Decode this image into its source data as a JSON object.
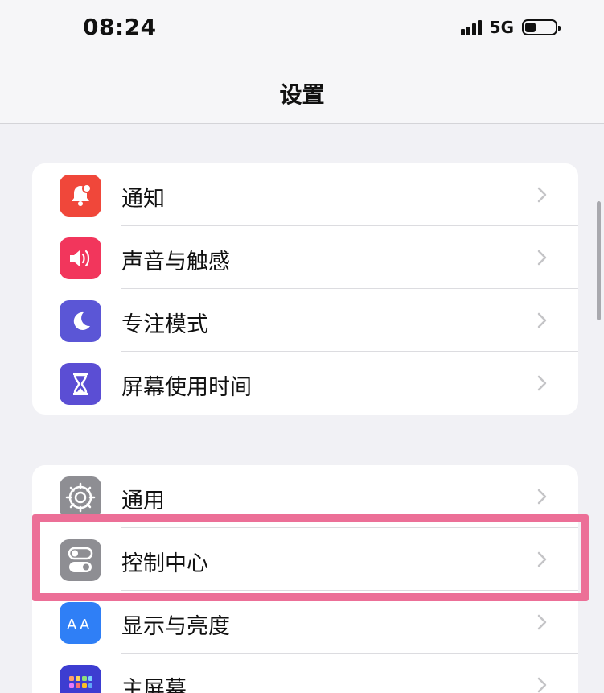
{
  "status_bar": {
    "time": "08:24",
    "network": "5G",
    "battery_level": 0.35
  },
  "nav": {
    "title": "设置"
  },
  "groups": [
    {
      "items": [
        {
          "label": "通知",
          "icon": "notification-icon",
          "color": "#f0473a"
        },
        {
          "label": "声音与触感",
          "icon": "speaker-icon",
          "color": "#f2365c"
        },
        {
          "label": "专注模式",
          "icon": "moon-icon",
          "color": "#5b56d6"
        },
        {
          "label": "屏幕使用时间",
          "icon": "hourglass-icon",
          "color": "#5b4ed4"
        }
      ]
    },
    {
      "items": [
        {
          "label": "通用",
          "icon": "gear-icon",
          "color": "#8e8e93"
        },
        {
          "label": "控制中心",
          "icon": "toggle-switches-icon",
          "color": "#8e8e93"
        },
        {
          "label": "显示与亮度",
          "icon": "text-size-icon",
          "color": "#2f7ff6"
        },
        {
          "label": "主屏幕",
          "icon": "home-screen-icon",
          "color": "#3d3dd1"
        }
      ]
    }
  ],
  "colors": {
    "highlight": "#ec6f97",
    "background": "#f1f1f5"
  }
}
